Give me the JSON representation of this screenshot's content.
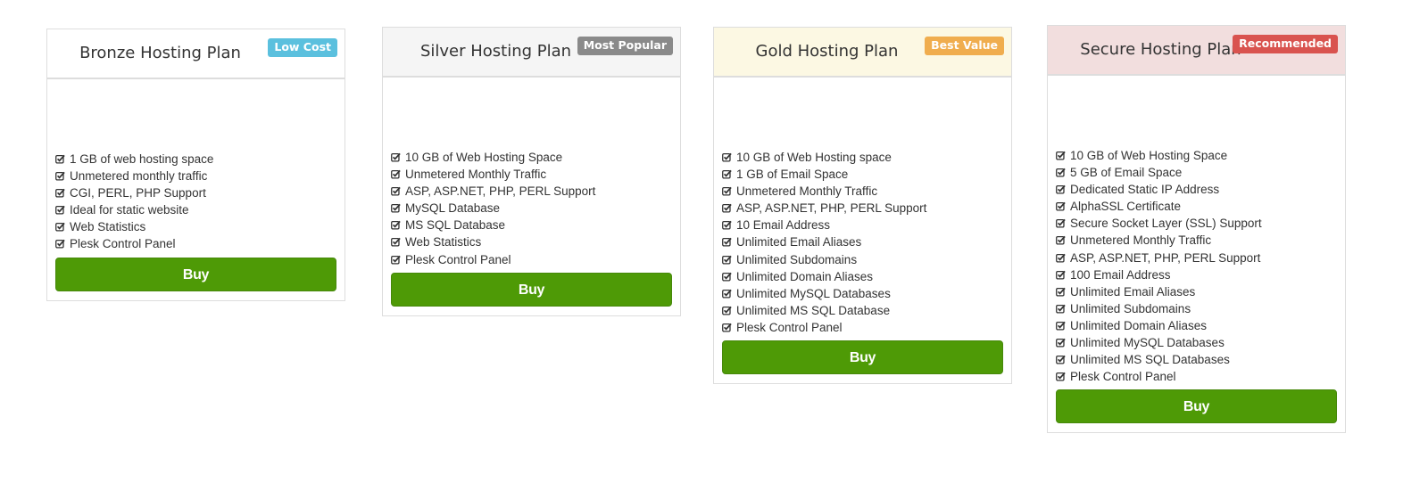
{
  "buy_label": "Buy",
  "plans": [
    {
      "title": "Bronze Hosting Plan",
      "badge": "Low Cost",
      "badge_color": "#5bc0de",
      "header_color": "#ffffff",
      "features": [
        "1 GB of web hosting space",
        "Unmetered monthly traffic",
        "CGI, PERL, PHP Support",
        "Ideal for static website",
        "Web Statistics",
        "Plesk Control Panel"
      ]
    },
    {
      "title": "Silver Hosting Plan",
      "badge": "Most Popular",
      "badge_color": "#8a8a8a",
      "header_color": "#f5f5f5",
      "features": [
        "10 GB of Web Hosting Space",
        "Unmetered Monthly Traffic",
        "ASP, ASP.NET, PHP, PERL Support",
        "MySQL Database",
        "MS SQL Database",
        "Web Statistics",
        "Plesk Control Panel"
      ]
    },
    {
      "title": "Gold Hosting Plan",
      "badge": "Best Value",
      "badge_color": "#f0ad4e",
      "header_color": "#fcf8e3",
      "features": [
        "10 GB of Web Hosting space",
        "1 GB of Email Space",
        "Unmetered Monthly Traffic",
        "ASP, ASP.NET, PHP, PERL Support",
        "10 Email Address",
        "Unlimited Email Aliases",
        "Unlimited Subdomains",
        "Unlimited Domain Aliases",
        "Unlimited MySQL Databases",
        "Unlimited MS SQL Database",
        "Plesk Control Panel"
      ]
    },
    {
      "title": "Secure Hosting Plan",
      "badge": "Recommended",
      "badge_color": "#d9534f",
      "header_color": "#f2dede",
      "features": [
        "10 GB of Web Hosting Space",
        "5 GB of Email Space",
        "Dedicated Static IP Address",
        "AlphaSSL Certificate",
        "Secure Socket Layer (SSL) Support",
        "Unmetered Monthly Traffic",
        "ASP, ASP.NET, PHP, PERL Support",
        "100 Email Address",
        "Unlimited Email Aliases",
        "Unlimited Subdomains",
        "Unlimited Domain Aliases",
        "Unlimited MySQL Databases",
        "Unlimited MS SQL Databases",
        "Plesk Control Panel"
      ]
    }
  ],
  "feature_icon": "check-square-o-icon",
  "button_color": "#4e9a06"
}
